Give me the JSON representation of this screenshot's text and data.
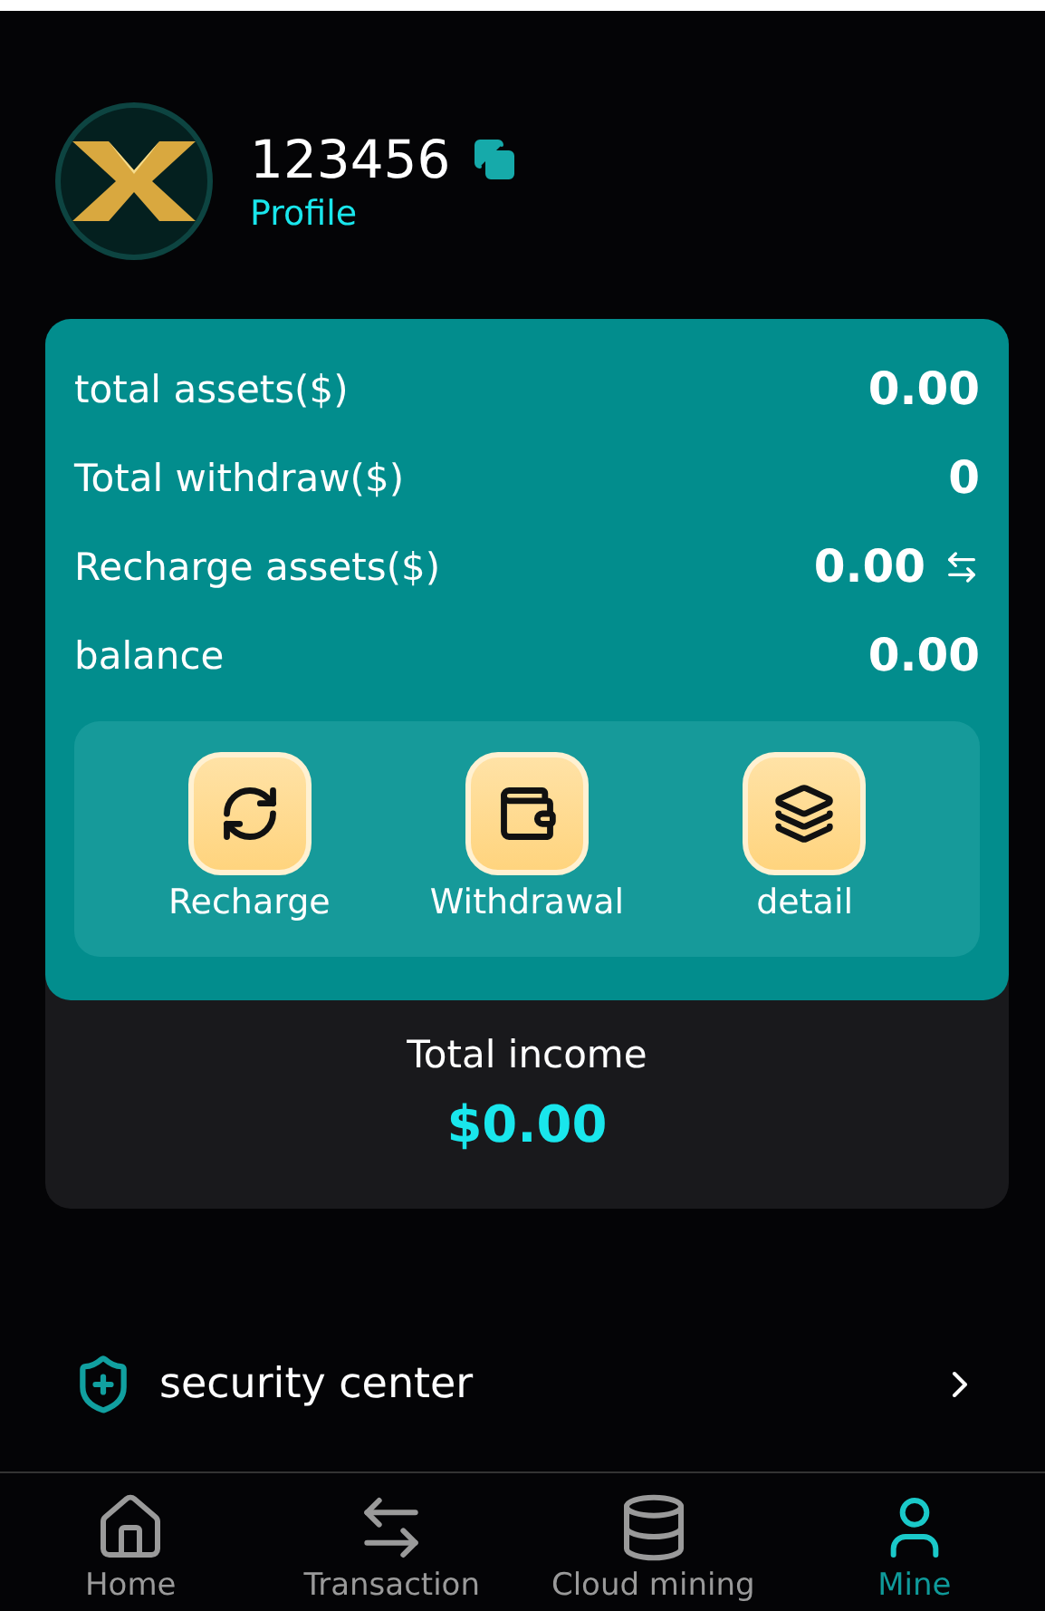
{
  "profile": {
    "user_id": "123456",
    "link": "Profile"
  },
  "assets": [
    {
      "label": "total assets($)",
      "value": "0.00",
      "kind": "plain"
    },
    {
      "label": "Total withdraw($)",
      "value": "0",
      "kind": "plain"
    },
    {
      "label": "Recharge assets($)",
      "value": "0.00",
      "kind": "exchange"
    },
    {
      "label": "balance",
      "value": "0.00",
      "kind": "plain"
    }
  ],
  "actions": [
    {
      "label": "Recharge",
      "kind": "recharge"
    },
    {
      "label": "Withdrawal",
      "kind": "wallet"
    },
    {
      "label": "detail",
      "kind": "layers"
    }
  ],
  "income": {
    "label": "Total income",
    "value": "$0.00"
  },
  "menu": [
    {
      "label": "security center"
    }
  ],
  "tabs": [
    {
      "label": "Home",
      "kind": "home",
      "selected": false
    },
    {
      "label": "Transaction",
      "kind": "transaction",
      "selected": false
    },
    {
      "label": "Cloud mining",
      "kind": "mining",
      "selected": false
    },
    {
      "label": "Mine",
      "kind": "user",
      "selected": true
    }
  ]
}
